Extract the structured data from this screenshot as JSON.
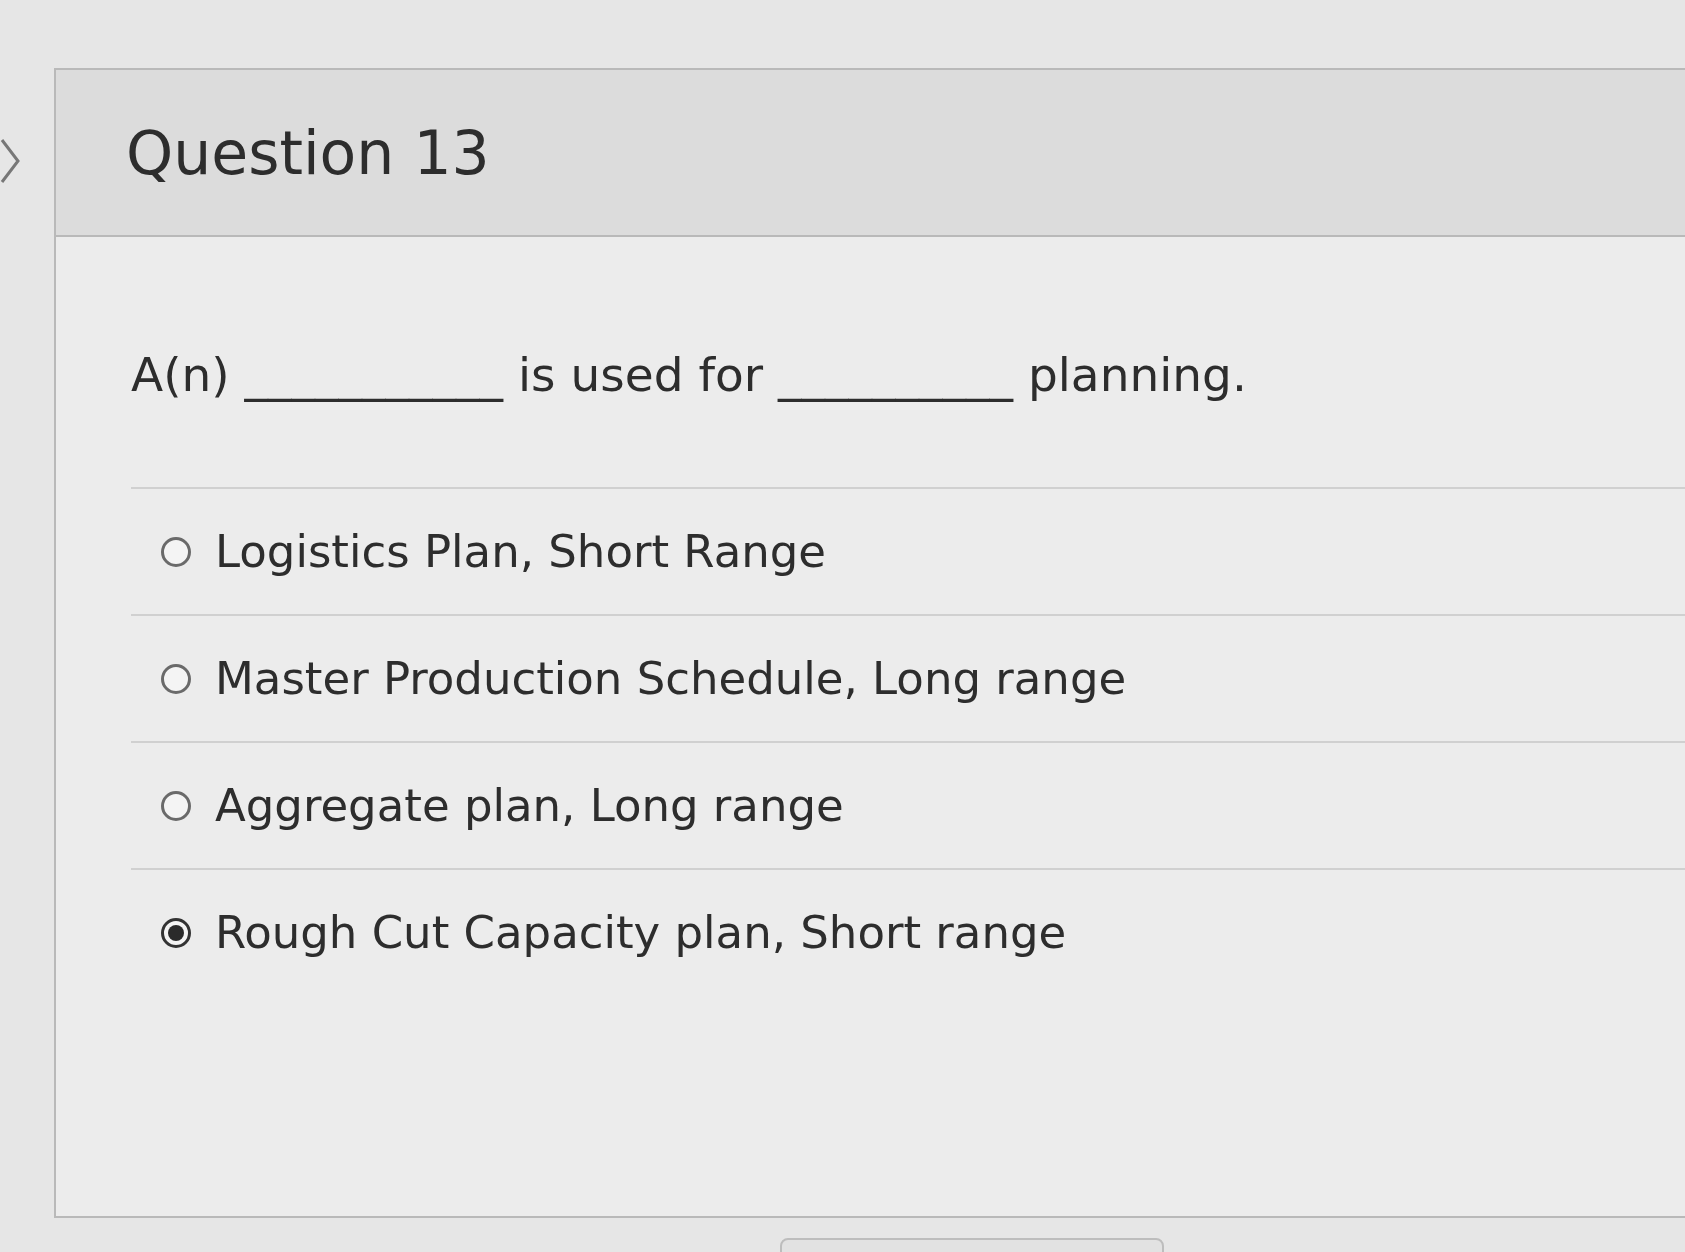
{
  "question": {
    "title": "Question 13",
    "prompt": "A(n) ___________ is used for __________ planning.",
    "options": [
      {
        "label": "Logistics Plan, Short Range",
        "selected": false
      },
      {
        "label": "Master Production Schedule, Long range",
        "selected": false
      },
      {
        "label": "Aggregate plan, Long range",
        "selected": false
      },
      {
        "label": "Rough Cut Capacity plan, Short range",
        "selected": true
      }
    ]
  }
}
